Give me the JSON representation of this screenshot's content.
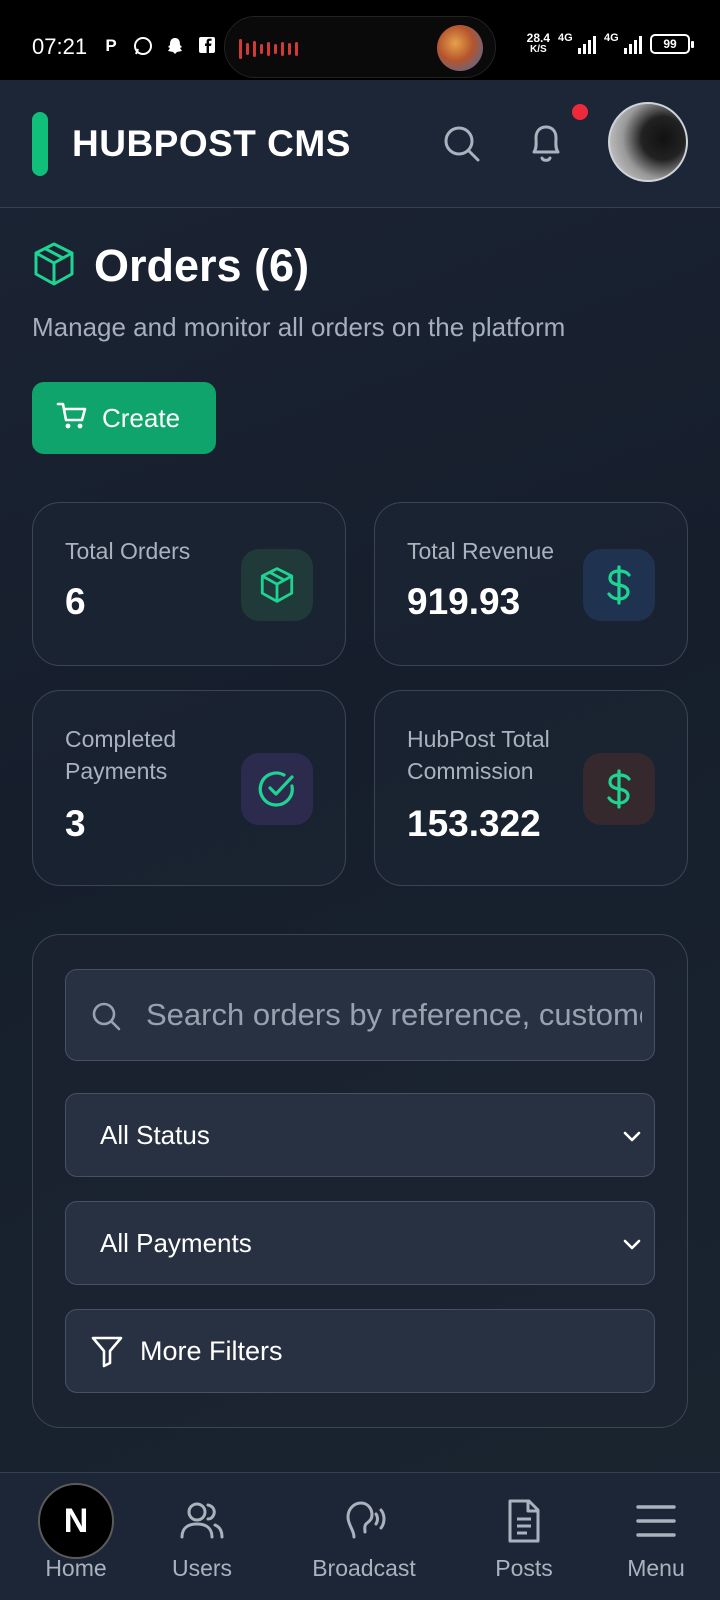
{
  "status_bar": {
    "time": "07:21",
    "net_speed": "28.4",
    "net_unit": "K/S",
    "signal1": "4G",
    "signal2": "4G",
    "battery": "99"
  },
  "header": {
    "title": "HUBPOST CMS"
  },
  "page": {
    "title": "Orders (6)",
    "subtitle": "Manage and monitor all orders on the platform",
    "create_label": "Create"
  },
  "stats": [
    {
      "label": "Total Orders",
      "value": "6",
      "icon": "box-icon"
    },
    {
      "label": "Total Revenue",
      "value": "919.93",
      "icon": "dollar-icon"
    },
    {
      "label": "Completed Payments",
      "value": "3",
      "icon": "check-circle-icon"
    },
    {
      "label": "HubPost Total Commission",
      "value": "153.322",
      "icon": "dollar-icon"
    }
  ],
  "filters": {
    "search_placeholder": "Search orders by reference, customer...",
    "status_select": "All Status",
    "payment_select": "All Payments",
    "more_filters": "More Filters"
  },
  "nav": [
    {
      "label": "Home",
      "icon": "home-icon"
    },
    {
      "label": "Users",
      "icon": "users-icon"
    },
    {
      "label": "Broadcast",
      "icon": "broadcast-icon"
    },
    {
      "label": "Posts",
      "icon": "document-icon"
    },
    {
      "label": "Menu",
      "icon": "menu-icon"
    }
  ],
  "overlay_badge": "N",
  "colors": {
    "accent": "#0fa46b",
    "brand_bar": "#10c07a",
    "icon_green": "#1fd493",
    "notification": "#ee2a3a",
    "background": "#1a2232"
  }
}
